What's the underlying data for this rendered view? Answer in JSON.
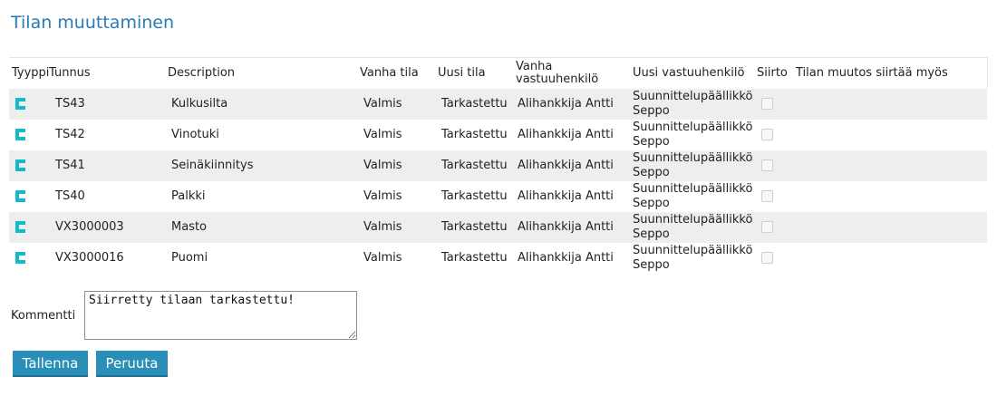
{
  "page": {
    "title": "Tilan muuttaminen"
  },
  "table": {
    "headers": {
      "tyyppi": "Tyyppi",
      "tunnus": "Tunnus",
      "description": "Description",
      "vanha_tila": "Vanha tila",
      "uusi_tila": "Uusi tila",
      "vanha_vastuuhenkilo": "Vanha vastuuhenkilö",
      "uusi_vastuuhenkilo": "Uusi vastuuhenkilö",
      "siirto": "Siirto",
      "tilan_muutos": "Tilan muutos siirtää myös"
    },
    "rows": [
      {
        "type_icon": "component-c-icon",
        "tunnus": "TS43",
        "description": "Kulkusilta",
        "vanha_tila": "Valmis",
        "uusi_tila": "Tarkastettu",
        "vanha_vastuu": "Alihankkija Antti",
        "uusi_vastuu_1": "Suunnittelupäällikkö",
        "uusi_vastuu_2": "Seppo",
        "siirto_checked": false
      },
      {
        "type_icon": "component-c-icon",
        "tunnus": "TS42",
        "description": "Vinotuki",
        "vanha_tila": "Valmis",
        "uusi_tila": "Tarkastettu",
        "vanha_vastuu": "Alihankkija Antti",
        "uusi_vastuu_1": "Suunnittelupäällikkö",
        "uusi_vastuu_2": "Seppo",
        "siirto_checked": false
      },
      {
        "type_icon": "component-c-icon",
        "tunnus": "TS41",
        "description": "Seinäkiinnitys",
        "vanha_tila": "Valmis",
        "uusi_tila": "Tarkastettu",
        "vanha_vastuu": "Alihankkija Antti",
        "uusi_vastuu_1": "Suunnittelupäällikkö",
        "uusi_vastuu_2": "Seppo",
        "siirto_checked": false
      },
      {
        "type_icon": "component-c-icon",
        "tunnus": "TS40",
        "description": "Palkki",
        "vanha_tila": "Valmis",
        "uusi_tila": "Tarkastettu",
        "vanha_vastuu": "Alihankkija Antti",
        "uusi_vastuu_1": "Suunnittelupäällikkö",
        "uusi_vastuu_2": "Seppo",
        "siirto_checked": false
      },
      {
        "type_icon": "component-c-icon",
        "tunnus": "VX3000003",
        "description": "Masto",
        "vanha_tila": "Valmis",
        "uusi_tila": "Tarkastettu",
        "vanha_vastuu": "Alihankkija Antti",
        "uusi_vastuu_1": "Suunnittelupäällikkö",
        "uusi_vastuu_2": "Seppo",
        "siirto_checked": false
      },
      {
        "type_icon": "component-c-icon",
        "tunnus": "VX3000016",
        "description": "Puomi",
        "vanha_tila": "Valmis",
        "uusi_tila": "Tarkastettu",
        "vanha_vastuu": "Alihankkija Antti",
        "uusi_vastuu_1": "Suunnittelupäällikkö",
        "uusi_vastuu_2": "Seppo",
        "siirto_checked": false
      }
    ]
  },
  "comment": {
    "label": "Kommentti",
    "value": "Siirretty tilaan tarkastettu!"
  },
  "buttons": {
    "save": "Tallenna",
    "cancel": "Peruuta"
  },
  "colors": {
    "title": "#2a7ab5",
    "button": "#2a8fb8",
    "icon": "#11bcc8",
    "row_stripe": "#eeeeee"
  }
}
